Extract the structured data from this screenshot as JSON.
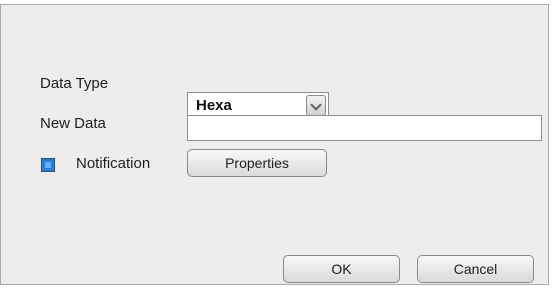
{
  "form": {
    "data_type_label": "Data Type",
    "data_type_value": "Hexa",
    "new_data_label": "New Data",
    "new_data_value": "",
    "notification_label": "Notification",
    "notification_checked": true,
    "properties_label": "Properties"
  },
  "buttons": {
    "ok_label": "OK",
    "cancel_label": "Cancel"
  },
  "icons": {
    "dropdown": "chevron-down-icon",
    "checkbox": "checkbox-checked-icon"
  },
  "colors": {
    "dialog_bg": "#eeedeb",
    "checkbox_accent": "#2c7fd0"
  }
}
